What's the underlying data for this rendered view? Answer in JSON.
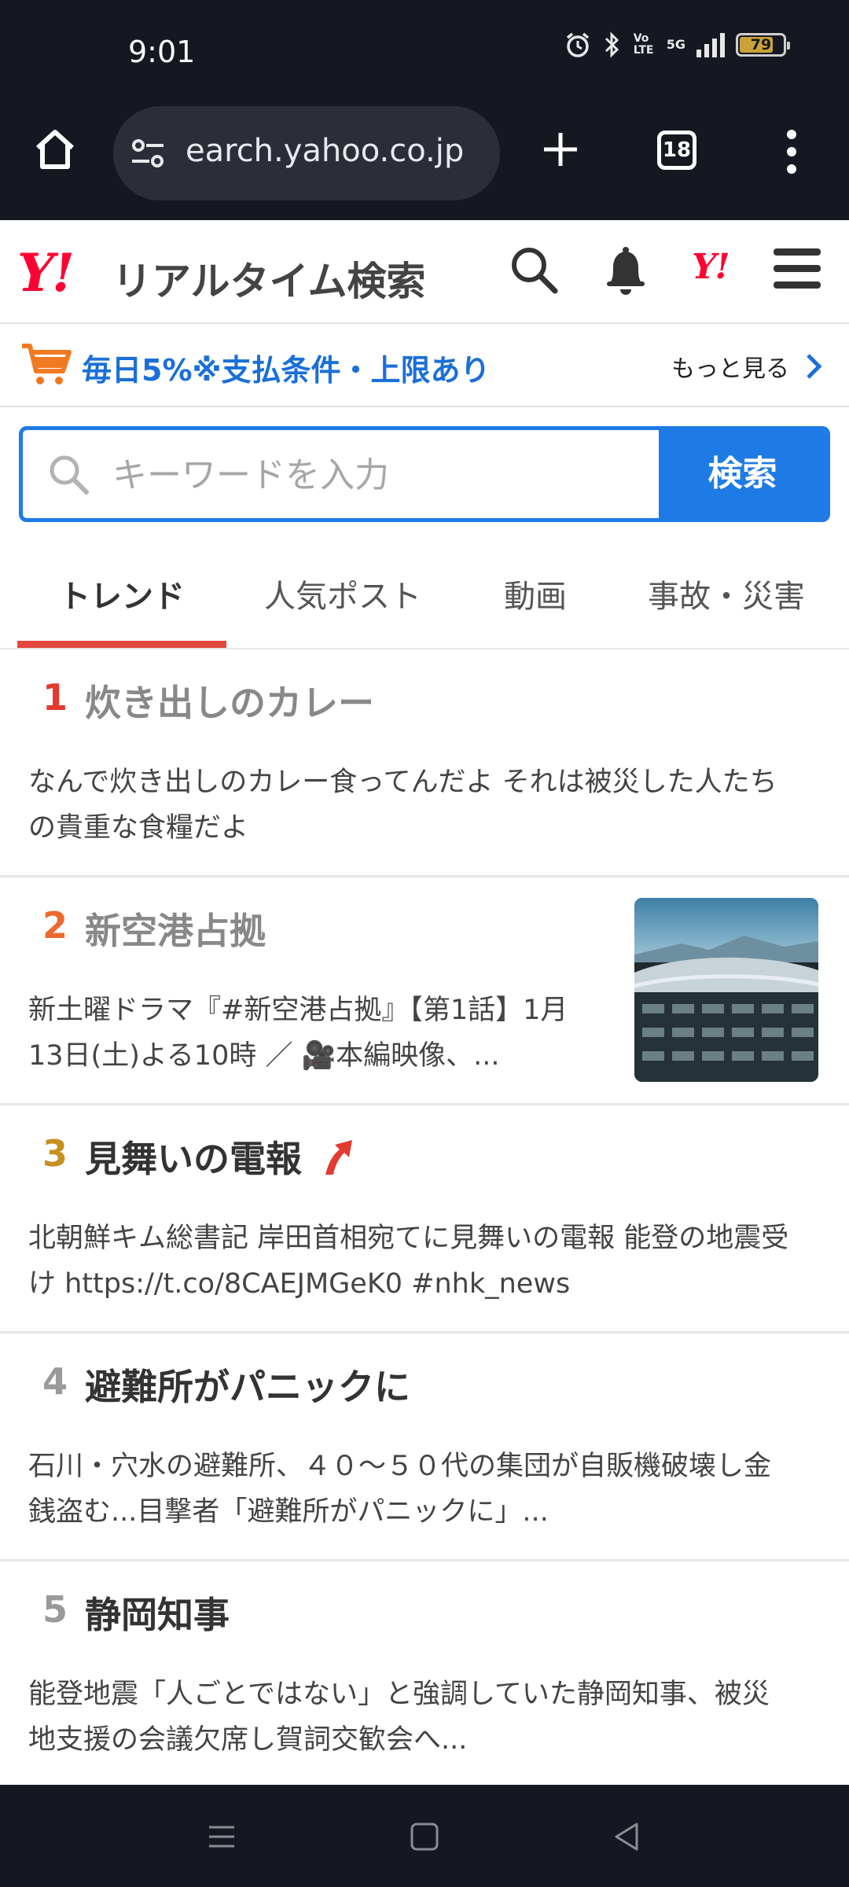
{
  "status_bar": {
    "time": "9:01",
    "net_top": "5G",
    "net_volte": "Vo LTE",
    "battery": "79",
    "battery_level": 0.79,
    "icons": [
      "alarm-icon",
      "bluetooth-icon",
      "volte-icon",
      "signal-icon",
      "battery-icon"
    ]
  },
  "browser": {
    "url": "earch.yahoo.co.jp",
    "tab_count": "18",
    "icons": [
      "home-icon",
      "site-settings-icon",
      "plus-icon",
      "tabs-icon",
      "more-vertical-icon"
    ]
  },
  "header": {
    "logo": "Y!",
    "service_name": "リアルタイム検索",
    "icons": [
      "search-icon",
      "bell-icon",
      "yahoo-logo-icon",
      "menu-icon"
    ]
  },
  "promo": {
    "text": "毎日5%※支払条件・上限あり",
    "more_label": "もっと見る",
    "icons": [
      "cart-icon",
      "chevron-right-icon"
    ]
  },
  "search": {
    "placeholder": "キーワードを入力",
    "value": "",
    "button_label": "検索"
  },
  "tabs": [
    {
      "label": "トレンド",
      "active": true
    },
    {
      "label": "人気ポスト",
      "active": false
    },
    {
      "label": "動画",
      "active": false
    },
    {
      "label": "事故・災害",
      "active": false
    }
  ],
  "trends": [
    {
      "rank": "1",
      "title": "炊き出しのカレー",
      "description": "なんで炊き出しのカレー食ってんだよ それは被災した人たちの貴重な食糧だよ",
      "rank_color": "#e23a2f",
      "has_thumbnail": false,
      "trending_up": false
    },
    {
      "rank": "2",
      "title": "新空港占拠",
      "description": "新土曜ドラマ『#新空港占拠』【第1話】1月13日(土)よる10時 ／ 🎥本編映像、...",
      "rank_color": "#ec6a2e",
      "has_thumbnail": true,
      "trending_up": false
    },
    {
      "rank": "3",
      "title": "見舞いの電報",
      "description": "北朝鮮キム総書記 岸田首相宛てに見舞いの電報 能登の地震受け https://t.co/8CAEJMGeK0 #nhk_news",
      "rank_color": "#c89020",
      "has_thumbnail": false,
      "trending_up": true
    },
    {
      "rank": "4",
      "title": "避難所がパニックに",
      "description": "石川・穴水の避難所、４０～５０代の集団が自販機破壊し金銭盗む...目撃者「避難所がパニックに」...",
      "rank_color": "#9a9a9a",
      "has_thumbnail": false,
      "trending_up": false
    },
    {
      "rank": "5",
      "title": "静岡知事",
      "description": "能登地震「人ごとではない」と強調していた静岡知事、被災地支援の会議欠席し賀詞交歓会へ...",
      "rank_color": "#9a9a9a",
      "has_thumbnail": false,
      "trending_up": false
    }
  ],
  "nav_bar": {
    "icons": [
      "recents-icon",
      "home-square-icon",
      "back-icon"
    ]
  }
}
